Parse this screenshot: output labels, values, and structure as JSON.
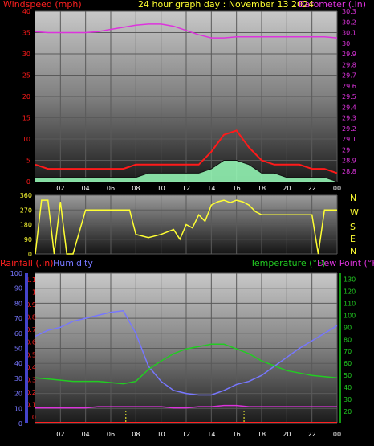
{
  "header": {
    "left": "Windspeed (mph)",
    "center": "24 hour graph day : November 13 2024",
    "right": "Barometer (.in)"
  },
  "lower_header": {
    "rainfall": "Rainfall (.in)",
    "humidity": "Humidity",
    "temperature": "Temperature (°F)",
    "dewpoint": "Dew Point (°F)"
  },
  "colors": {
    "wind_gust": "#ff1a1a",
    "wind_avg": "#ffffff",
    "wind_fill": "#99ffbb",
    "barometer": "#dd33dd",
    "direction": "#ffff33",
    "humidity": "#7777ff",
    "temperature": "#22cc22",
    "dewpoint": "#dd33dd",
    "rainfall": "#ff2222",
    "compass": "#ffff33"
  },
  "x_labels": [
    "02",
    "04",
    "06",
    "08",
    "10",
    "12",
    "14",
    "16",
    "18",
    "20",
    "22",
    "00"
  ],
  "compass": [
    "N",
    "W",
    "S",
    "E",
    "N"
  ],
  "chart_data": [
    {
      "type": "area",
      "title": "24 hour graph day : November 13 2024",
      "ylabel": "Windspeed (mph)",
      "y2label": "Barometer (.in)",
      "ylim": [
        0,
        40
      ],
      "y_ticks": [
        0,
        5,
        10,
        15,
        20,
        25,
        30,
        35,
        40
      ],
      "y2lim": [
        28.7,
        30.3
      ],
      "y2_ticks": [
        "28.8",
        "28.9",
        "29",
        "29.1",
        "29.2",
        "29.3",
        "29.4",
        "29.5",
        "29.6",
        "29.7",
        "29.8",
        "29.9",
        "30",
        "30.1",
        "30.2",
        "30.3"
      ],
      "x_hours": [
        0,
        1,
        2,
        3,
        4,
        5,
        6,
        7,
        8,
        9,
        10,
        11,
        12,
        13,
        14,
        15,
        16,
        17,
        18,
        19,
        20,
        21,
        22,
        23,
        24
      ],
      "series": [
        {
          "name": "Windspeed (mph)",
          "kind": "gust",
          "values": [
            4,
            3,
            3,
            3,
            3,
            3,
            3,
            3,
            4,
            4,
            4,
            4,
            4,
            4,
            7,
            11,
            12,
            8,
            5,
            4,
            4,
            4,
            3,
            3,
            2
          ]
        },
        {
          "name": "Windspeed (mph)",
          "kind": "average",
          "values": [
            1,
            1,
            1,
            1,
            1,
            1,
            1,
            1,
            1,
            2,
            2,
            2,
            2,
            2,
            3,
            5,
            5,
            4,
            2,
            2,
            1,
            1,
            1,
            1,
            0
          ]
        },
        {
          "name": "Barometer (.in)",
          "values": [
            30.11,
            30.1,
            30.1,
            30.1,
            30.1,
            30.11,
            30.13,
            30.15,
            30.17,
            30.18,
            30.18,
            30.16,
            30.12,
            30.08,
            30.05,
            30.05,
            30.06,
            30.06,
            30.06,
            30.06,
            30.06,
            30.06,
            30.06,
            30.06,
            30.05
          ]
        }
      ]
    },
    {
      "type": "line",
      "ylabel": "Wind Direction",
      "ylim": [
        0,
        360
      ],
      "y_ticks": [
        0,
        90,
        180,
        270,
        360
      ],
      "x_hours": [
        0,
        0.5,
        1,
        1.5,
        2,
        2.5,
        3,
        4,
        5,
        6,
        7,
        7.5,
        8,
        9,
        10,
        11,
        11.5,
        12,
        12.5,
        13,
        13.5,
        14,
        14.5,
        15,
        15.5,
        16,
        16.5,
        17,
        17.5,
        18,
        19,
        20,
        21,
        22,
        22.5,
        23,
        24
      ],
      "values": [
        0,
        330,
        330,
        0,
        320,
        0,
        0,
        270,
        270,
        270,
        270,
        270,
        120,
        100,
        120,
        150,
        90,
        180,
        160,
        240,
        200,
        300,
        320,
        330,
        315,
        330,
        320,
        300,
        260,
        240,
        240,
        240,
        240,
        240,
        0,
        270,
        270
      ]
    },
    {
      "type": "line",
      "ylabel": "Rainfall (.in) / Humidity",
      "y2label": "Temperature (°F) Dew Point (°F)",
      "ylim": [
        0,
        100
      ],
      "y_ticks": [
        0,
        10,
        20,
        30,
        40,
        50,
        60,
        70,
        80,
        90,
        100
      ],
      "rain_ticks": [
        "0",
        "0.1",
        "0.2",
        "0.3",
        "0.4",
        "0.5",
        "0.6",
        "0.7",
        "0.8",
        "0.9",
        "1",
        "1.1"
      ],
      "y2lim": [
        10,
        135
      ],
      "y2_ticks": [
        20,
        30,
        40,
        50,
        60,
        70,
        80,
        90,
        100,
        110,
        120,
        130
      ],
      "x_hours": [
        0,
        1,
        2,
        3,
        4,
        5,
        6,
        7,
        8,
        9,
        10,
        11,
        12,
        13,
        14,
        15,
        16,
        17,
        18,
        19,
        20,
        21,
        22,
        23,
        24
      ],
      "series": [
        {
          "name": "Humidity",
          "values": [
            58,
            62,
            64,
            68,
            70,
            72,
            74,
            75,
            60,
            38,
            28,
            22,
            20,
            19,
            19,
            22,
            26,
            28,
            32,
            38,
            44,
            50,
            55,
            60,
            65
          ]
        },
        {
          "name": "Temperature (°F)",
          "values": [
            48,
            47,
            46,
            45,
            45,
            45,
            44,
            43,
            45,
            55,
            62,
            68,
            72,
            74,
            76,
            76,
            72,
            68,
            62,
            58,
            54,
            52,
            50,
            49,
            48
          ]
        },
        {
          "name": "Dew Point (°F)",
          "values": [
            23,
            23,
            23,
            23,
            23,
            24,
            24,
            24,
            24,
            24,
            24,
            23,
            23,
            24,
            24,
            25,
            25,
            24,
            24,
            24,
            24,
            24,
            24,
            24,
            24
          ]
        },
        {
          "name": "Rainfall (.in)",
          "values": [
            0,
            0,
            0,
            0,
            0,
            0,
            0,
            0,
            0,
            0,
            0,
            0,
            0,
            0,
            0,
            0,
            0,
            0,
            0,
            0,
            0,
            0,
            0,
            0,
            0
          ]
        }
      ]
    }
  ]
}
